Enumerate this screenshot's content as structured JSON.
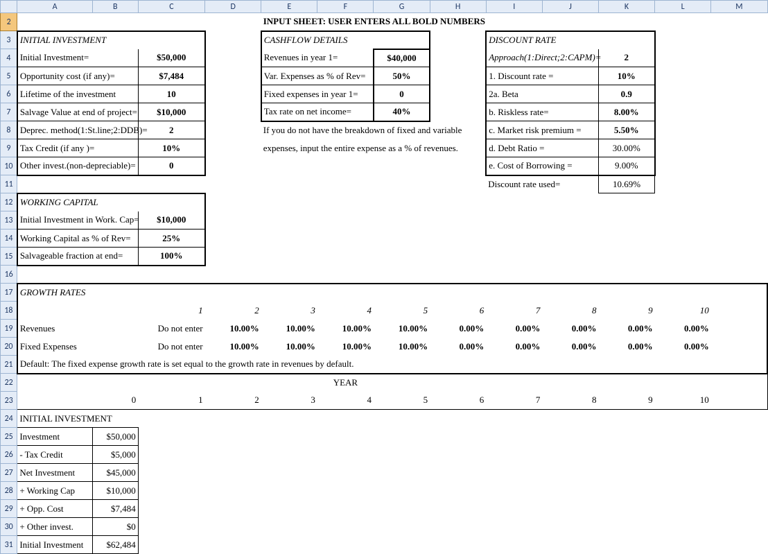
{
  "title": "INPUT SHEET: USER ENTERS ALL BOLD NUMBERS",
  "columns": [
    "A",
    "B",
    "C",
    "D",
    "E",
    "F",
    "G",
    "H",
    "I",
    "J",
    "K",
    "L",
    "M"
  ],
  "initial_investment": {
    "header": "INITIAL INVESTMENT",
    "rows": [
      {
        "label": "Initial Investment=",
        "value": "$50,000"
      },
      {
        "label": "Opportunity cost (if any)=",
        "value": "$7,484"
      },
      {
        "label": "Lifetime of the investment",
        "value": "10"
      },
      {
        "label": "Salvage Value at end of project=",
        "value": "$10,000"
      },
      {
        "label": "Deprec. method(1:St.line;2:DDB)=",
        "value": "2"
      },
      {
        "label": "Tax Credit (if any )=",
        "value": "10%"
      },
      {
        "label": "Other invest.(non-depreciable)=",
        "value": "0"
      }
    ]
  },
  "cashflow": {
    "header": "CASHFLOW DETAILS",
    "rows": [
      {
        "label": "Revenues in  year 1=",
        "value": "$40,000"
      },
      {
        "label": "Var. Expenses as % of Rev=",
        "value": "50%"
      },
      {
        "label": "Fixed expenses in year 1=",
        "value": "0"
      },
      {
        "label": "Tax rate on net income=",
        "value": "40%"
      }
    ],
    "note1": "If you do not have the breakdown of fixed and variable",
    "note2": "expenses, input the entire expense as a % of revenues."
  },
  "discount": {
    "header": "DISCOUNT RATE",
    "approach_label": "Approach(1:Direct;2:CAPM)=",
    "approach_value": "2",
    "rows": [
      {
        "label": "1. Discount rate =",
        "value": "10%"
      },
      {
        "label": "2a. Beta",
        "value": "0.9"
      },
      {
        "label": "b. Riskless rate=",
        "value": "8.00%"
      },
      {
        "label": "c. Market risk premium =",
        "value": "5.50%"
      },
      {
        "label": "d. Debt Ratio =",
        "value": "30.00%"
      },
      {
        "label": "e. Cost of Borrowing =",
        "value": "9.00%"
      }
    ],
    "used_label": "Discount rate used=",
    "used_value": "10.69%"
  },
  "working_capital": {
    "header": "WORKING CAPITAL",
    "rows": [
      {
        "label": "Initial Investment in Work. Cap=",
        "value": "$10,000"
      },
      {
        "label": "Working Capital as % of Rev=",
        "value": "25%"
      },
      {
        "label": "Salvageable fraction at end=",
        "value": "100%"
      }
    ]
  },
  "growth": {
    "header": "GROWTH RATES",
    "years": [
      "1",
      "2",
      "3",
      "4",
      "5",
      "6",
      "7",
      "8",
      "9",
      "10"
    ],
    "revenues_label": "Revenues",
    "revenues": [
      "Do not enter",
      "10.00%",
      "10.00%",
      "10.00%",
      "10.00%",
      "0.00%",
      "0.00%",
      "0.00%",
      "0.00%",
      "0.00%"
    ],
    "fixed_label": "Fixed Expenses",
    "fixed": [
      "Do not enter",
      "10.00%",
      "10.00%",
      "10.00%",
      "10.00%",
      "0.00%",
      "0.00%",
      "0.00%",
      "0.00%",
      "0.00%"
    ],
    "default_note": "Default: The fixed expense growth rate is set equal to the growth rate in revenues by default."
  },
  "year_header": "YEAR",
  "year_numbers": [
    "0",
    "1",
    "2",
    "3",
    "4",
    "5",
    "6",
    "7",
    "8",
    "9",
    "10"
  ],
  "init_inv_detail": {
    "header": "INITIAL INVESTMENT",
    "rows": [
      {
        "label": "Investment",
        "value": "$50,000"
      },
      {
        "label": " - Tax Credit",
        "value": "$5,000"
      },
      {
        "label": "Net Investment",
        "value": "$45,000"
      },
      {
        "label": " + Working Cap",
        "value": "$10,000"
      },
      {
        "label": " + Opp. Cost",
        "value": "$7,484"
      },
      {
        "label": " + Other invest.",
        "value": "$0"
      },
      {
        "label": "Initial Investment",
        "value": "$62,484"
      }
    ]
  }
}
